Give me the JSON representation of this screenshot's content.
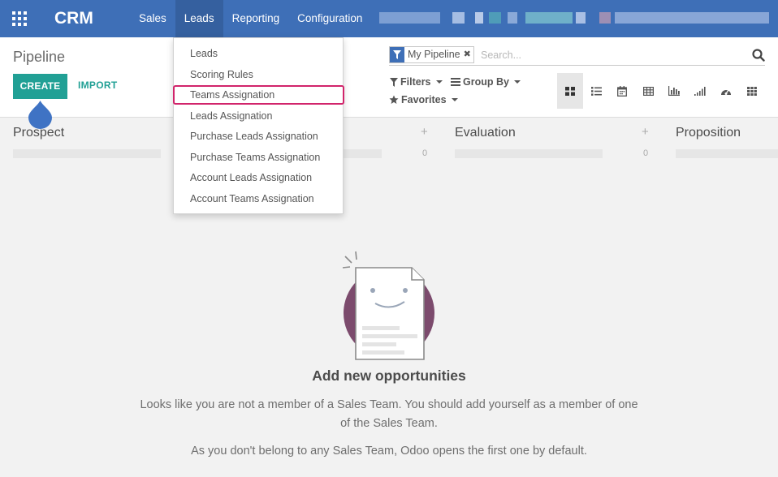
{
  "app": {
    "brand": "CRM",
    "menu": [
      "Sales",
      "Leads",
      "Reporting",
      "Configuration"
    ],
    "active_menu": "Leads"
  },
  "control_panel": {
    "breadcrumb": "Pipeline",
    "create_label": "CREATE",
    "import_label": "IMPORT",
    "search": {
      "facet": "My Pipeline",
      "placeholder": "Search..."
    },
    "filters_label": "Filters",
    "groupby_label": "Group By",
    "favorites_label": "Favorites",
    "views": [
      "kanban-view",
      "list-view",
      "calendar-view",
      "pivot-view",
      "graph-view",
      "cohort-view",
      "dashboard-view",
      "grid-view"
    ],
    "active_view": "kanban-view"
  },
  "kanban": {
    "columns": [
      {
        "title": "Prospect",
        "count": ""
      },
      {
        "title": "",
        "count": "0"
      },
      {
        "title": "Evaluation",
        "count": "0"
      },
      {
        "title": "Proposition",
        "count": ""
      }
    ]
  },
  "leads_menu": {
    "items": [
      "Leads",
      "Scoring Rules",
      "Teams Assignation",
      "Leads Assignation",
      "Purchase Leads Assignation",
      "Purchase Teams Assignation",
      "Account Leads Assignation",
      "Account Teams Assignation"
    ],
    "highlighted": "Teams Assignation"
  },
  "empty_state": {
    "title": "Add new opportunities",
    "line1": "Looks like you are not a member of a Sales Team. You should add yourself as a member of one of the Sales Team.",
    "line2": "As you don't belong to any Sales Team, Odoo opens the first one by default."
  },
  "colors": {
    "navbar": "#3e6fb7",
    "primary": "#21a095",
    "highlight": "#d1246b",
    "illustration_circle": "#7c4b6d"
  }
}
